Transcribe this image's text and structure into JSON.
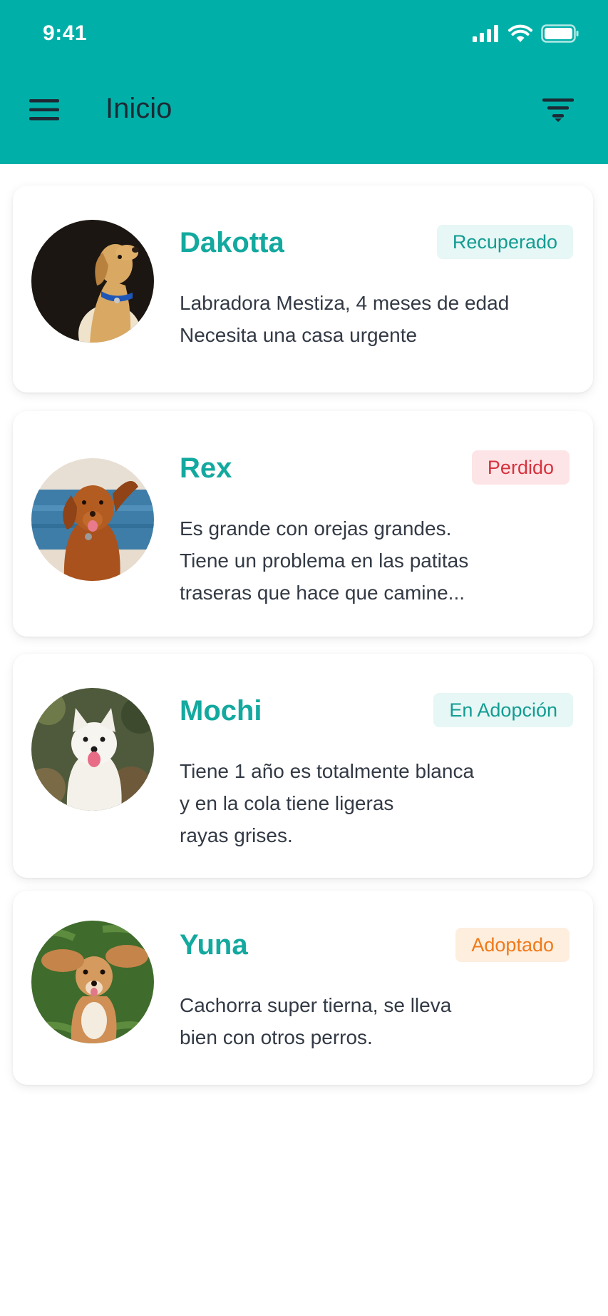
{
  "status_bar": {
    "time": "9:41"
  },
  "header": {
    "title": "Inicio",
    "background": "#00b0a8",
    "menu_icon": "hamburger-menu-icon",
    "filter_icon": "filter-icon"
  },
  "pets": [
    {
      "name": "Dakotta",
      "status": "Recuperado",
      "status_color": "#139c92",
      "status_bg": "#e6f7f5",
      "description": [
        "Labradora Mestiza, 4 meses de edad",
        "Necesita una casa urgente"
      ]
    },
    {
      "name": "Rex",
      "status": "Perdido",
      "status_color": "#d6323e",
      "status_bg": "#fde4e6",
      "description": [
        "Es grande con orejas grandes.",
        "Tiene un problema en las patitas",
        "traseras que hace que camine..."
      ]
    },
    {
      "name": "Mochi",
      "status": "En Adopción",
      "status_color": "#139c92",
      "status_bg": "#e6f7f5",
      "description": [
        "Tiene 1 año es totalmente blanca",
        "y en la cola tiene ligeras",
        "rayas grises."
      ]
    },
    {
      "name": "Yuna",
      "status": "Adoptado",
      "status_color": "#f07a1a",
      "status_bg": "#fdeede",
      "description": [
        "Cachorra super tierna, se lleva",
        "bien con otros perros."
      ]
    }
  ]
}
